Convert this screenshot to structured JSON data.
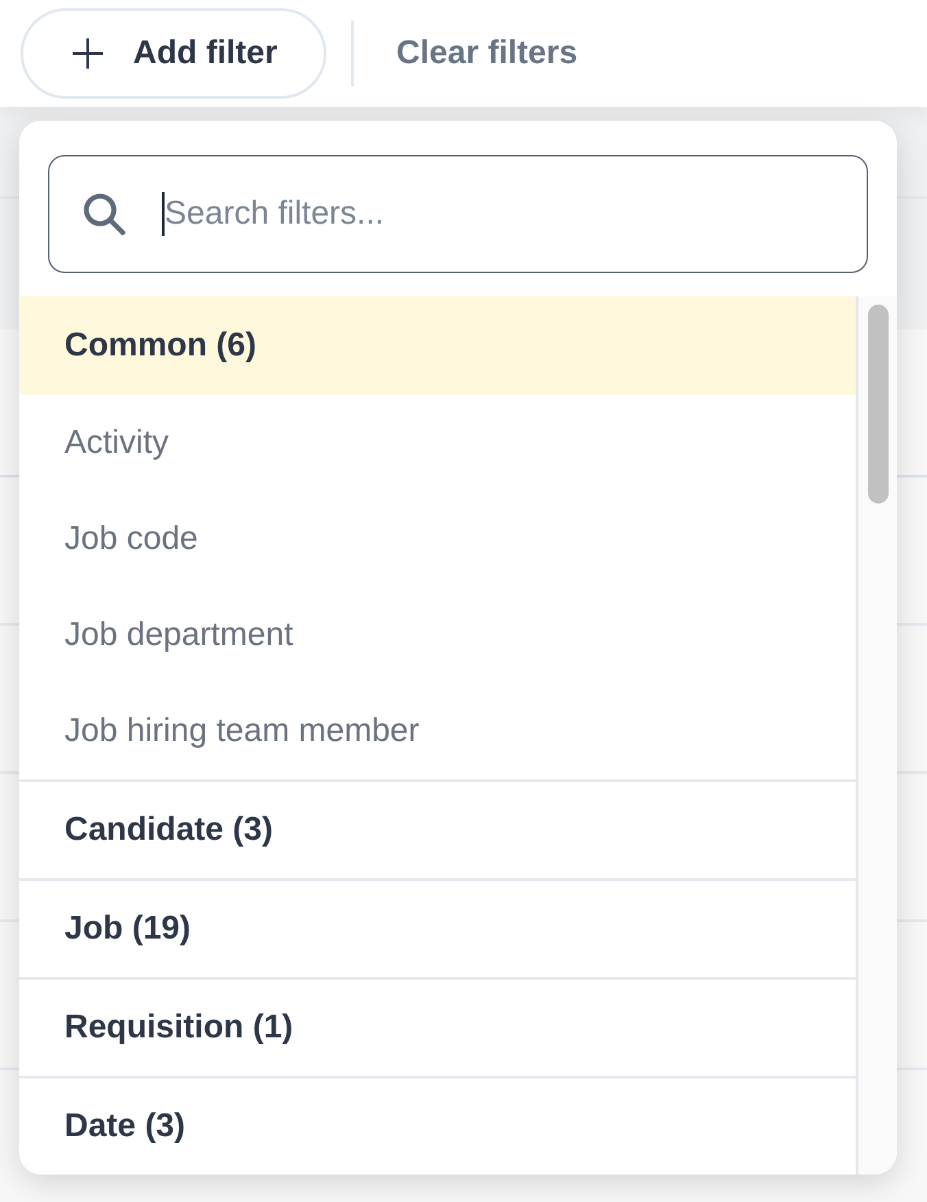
{
  "toolbar": {
    "add_filter_button": {
      "label": "Add filter"
    },
    "clear_filters_button": {
      "label": "Clear filters"
    }
  },
  "filter_menu": {
    "search": {
      "placeholder": "Search filters...",
      "focused": true
    },
    "groups": [
      {
        "label": "Common (6)",
        "selected": true,
        "children": [
          {
            "label": "Activity",
            "selected": false
          },
          {
            "label": "Job code",
            "selected": false
          },
          {
            "label": "Job department",
            "selected": false
          },
          {
            "label": "Job hiring team member",
            "selected": false
          }
        ]
      },
      {
        "label": "Candidate (3)",
        "selected": false
      },
      {
        "label": "Job (19)",
        "selected": false
      },
      {
        "label": "Requisition (1)",
        "selected": false
      },
      {
        "label": "Date (3)",
        "selected": false
      }
    ]
  }
}
